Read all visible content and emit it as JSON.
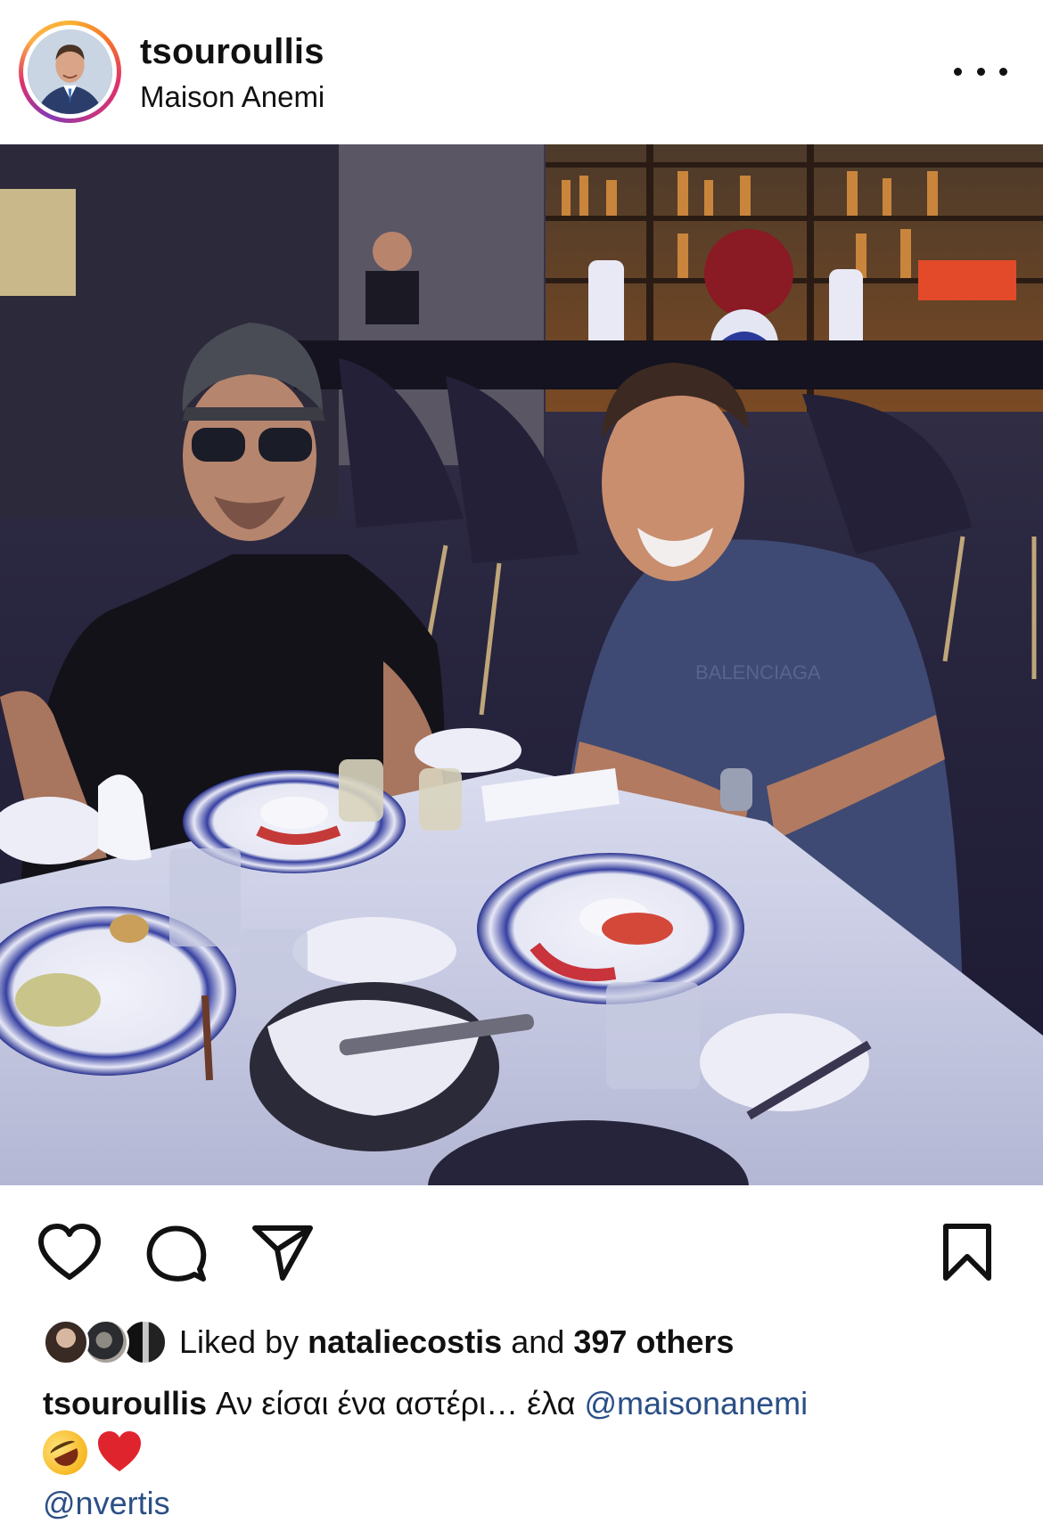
{
  "header": {
    "username": "tsouroullis",
    "location": "Maison Anemi",
    "more_icon": "more-horizontal-icon"
  },
  "photo": {
    "bottle_label": "BALENCIAGA"
  },
  "actions": {
    "like_icon": "heart-icon",
    "comment_icon": "comment-icon",
    "share_icon": "send-icon",
    "save_icon": "bookmark-icon"
  },
  "likes": {
    "prefix": "Liked by",
    "user": "nataliecostis",
    "middle": "and",
    "count_text": "397 others"
  },
  "caption": {
    "username": "tsouroullis",
    "text": "Αν είσαι ένα αστέρι… έλα",
    "mention_1": "@maisonanemi",
    "emojis": [
      "rolling-on-floor-laughing-emoji",
      "red-heart-emoji"
    ],
    "mention_2": "@nvertis"
  },
  "colors": {
    "text": "#111111",
    "mention": "#2b4f86",
    "story_ring_start": "#f9b233",
    "story_ring_end": "#c13584"
  }
}
